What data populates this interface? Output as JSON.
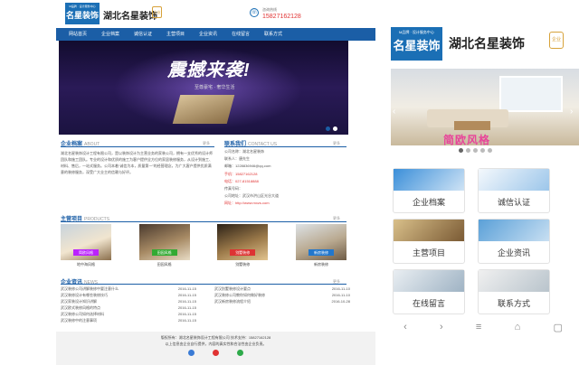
{
  "desktop": {
    "logo_small": "M品牌 · 设计服务中心",
    "logo_name": "名星装饰",
    "brand": "湖北名星装饰",
    "badge": "企业",
    "phone_label": "咨询热线",
    "phone": "15827162128",
    "nav": [
      "网站首页",
      "企业档案",
      "诚信认证",
      "主营项目",
      "企业资讯",
      "在线留言",
      "联系方式"
    ],
    "banner": {
      "title": "震撼来袭!",
      "subtitle": "至尊豪宅 · 奢华生活"
    },
    "about": {
      "title": "企业档案",
      "en": "ABOUT",
      "more": "更多",
      "text": "湖北名星装饰设计工程有限公司，是以装饰设计为主营业务的家装公司，拥有一支优秀的设计师团队和施工团队。专业的设计和优质的施工为客户提供全方位的家居装修服务，从设计到施工、材料、售后，一站式服务。公司本着“诚信为本，质量第一”的经营理念，为广大客户提供优质满意的装修服务，深受广大业主的信赖与好评。"
    },
    "contact": {
      "title": "联系我们",
      "en": "CONTACT US",
      "more": "更多",
      "lines": [
        "公司名称：湖北名星装饰",
        "联系人：唐先生",
        "邮箱：1228836946@qq.com",
        "手机：15827162128",
        "电话：027-81518888",
        "传真号码：",
        "公司地址：武汉市洪山区光谷大道",
        "网址：http://www.mxzs.com"
      ]
    },
    "products": {
      "title": "主营项目",
      "en": "PRODUCTS",
      "more": "更多",
      "items": [
        {
          "caption": "地中海风格",
          "tag": "简欧风格"
        },
        {
          "caption": "田园风格",
          "tag": "田园风格"
        },
        {
          "caption": "别墅装修",
          "tag": "别墅装修"
        },
        {
          "caption": "新房装修",
          "tag": "新房装修"
        }
      ]
    },
    "news": {
      "title": "企业资讯",
      "en": "NEWS",
      "more": "更多",
      "left": [
        {
          "t": "武汉装修公司讲解装修中要注意什么",
          "d": "2016-11-15"
        },
        {
          "t": "武汉装修设计有哪些装修技巧",
          "d": "2016-11-15"
        },
        {
          "t": "武汉家装设计知识讲解",
          "d": "2016-11-15"
        },
        {
          "t": "武汉欧式装修风格的特点",
          "d": "2016-11-15"
        },
        {
          "t": "武汉装修公司如何选择材料",
          "d": "2016-11-15"
        },
        {
          "t": "武汉装修中的注意事项",
          "d": "2016-11-15"
        }
      ],
      "right": [
        {
          "t": "武汉别墅装修设计要点",
          "d": "2016-11-10"
        },
        {
          "t": "武汉装修公司教你如何做好装修",
          "d": "2016-11-10"
        },
        {
          "t": "武汉新房装修流程介绍",
          "d": "2016-10-28"
        }
      ]
    },
    "footer": {
      "line1": "版权所有：湖北名星装饰设计工程有限公司 技术支持：15827162128",
      "line2": "以上信息由企业自行提供，内容的真实性和合法性由企业负责。",
      "icon_colors": [
        "#3a7bd5",
        "#e03333",
        "#2eaa4a"
      ]
    }
  },
  "mobile": {
    "logo_small": "M品牌 · 设计服务中心",
    "logo_name": "名星装饰",
    "brand": "湖北名星装饰",
    "badge": "企业",
    "banner_text": "简欧风格",
    "tiles": [
      "企业档案",
      "诚信认证",
      "主营项目",
      "企业资讯",
      "在线留言",
      "联系方式"
    ],
    "bottom_bar": [
      "‹",
      "›",
      "≡",
      "⌂",
      "▢"
    ]
  },
  "colors": {
    "brand_blue": "#1b5ea6",
    "phone_red": "#e03333",
    "badge_gold": "#d7a23a"
  }
}
